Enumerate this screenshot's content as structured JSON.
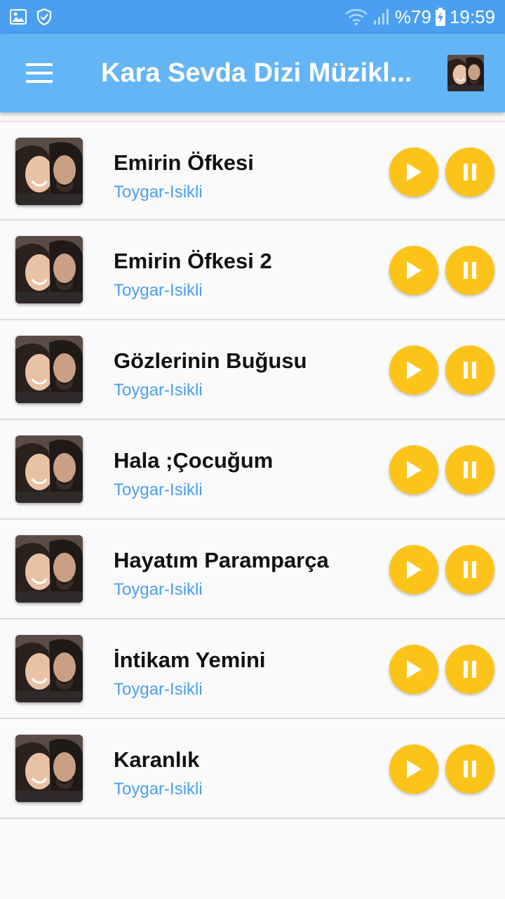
{
  "status_bar": {
    "battery": "%79",
    "time": "19:59"
  },
  "app_bar": {
    "title": "Kara Sevda Dizi Müzikl..."
  },
  "songs": [
    {
      "title": "Emirin Öfkesi",
      "artist": "Toygar-Isikli"
    },
    {
      "title": "Emirin Öfkesi 2",
      "artist": "Toygar-Isikli"
    },
    {
      "title": "Gözlerinin Buğusu",
      "artist": "Toygar-Isikli"
    },
    {
      "title": "Hala ;Çocuğum",
      "artist": "Toygar-Isikli"
    },
    {
      "title": "Hayatım Paramparça",
      "artist": "Toygar-Isikli"
    },
    {
      "title": "İntikam Yemini",
      "artist": "Toygar-Isikli"
    },
    {
      "title": "Karanlık",
      "artist": "Toygar-Isikli"
    }
  ],
  "icons": {
    "menu": "menu-icon",
    "play": "play-icon",
    "pause": "pause-icon"
  },
  "colors": {
    "status_bar": "#4a9ff0",
    "app_bar": "#64b5f6",
    "button": "#fcc419",
    "artist_text": "#4a9ff0"
  }
}
